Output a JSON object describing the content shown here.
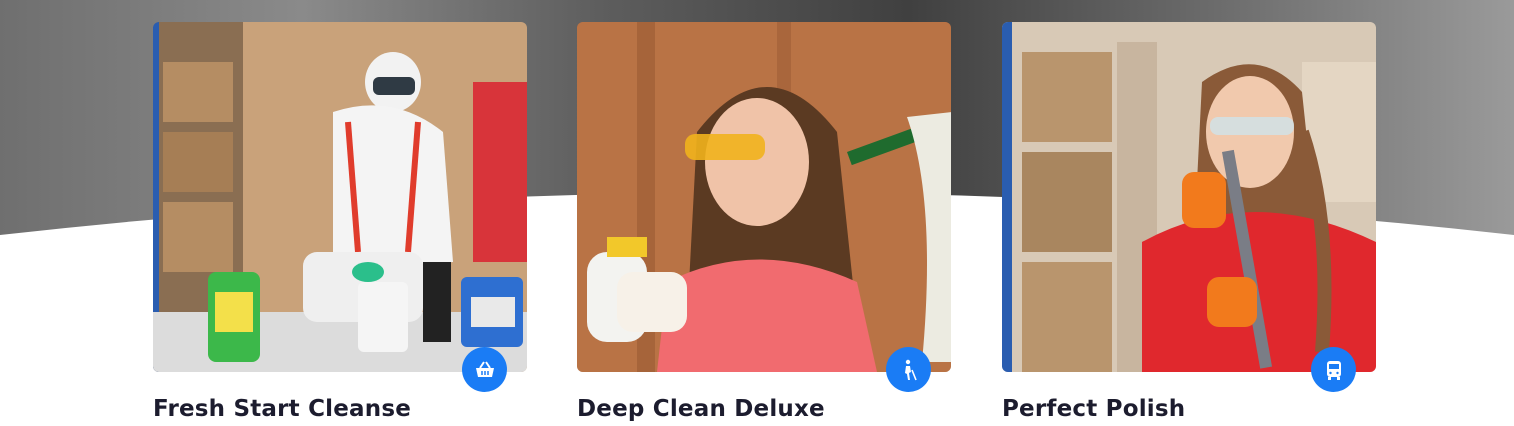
{
  "colors": {
    "accent": "#1a7cf5",
    "title": "#1c1c2e"
  },
  "services": [
    {
      "title": "Fresh Start Cleanse",
      "icon": "basket-icon"
    },
    {
      "title": "Deep Clean Deluxe",
      "icon": "person-with-cane-icon"
    },
    {
      "title": "Perfect Polish",
      "icon": "bus-icon"
    }
  ]
}
